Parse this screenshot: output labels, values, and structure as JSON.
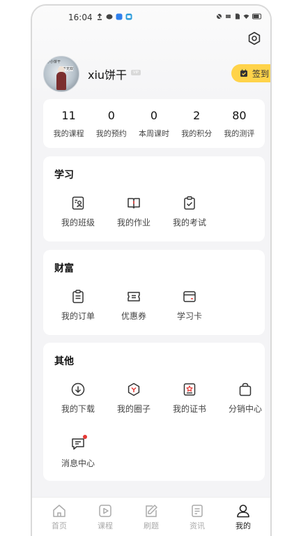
{
  "status_bar": {
    "time": "16:04"
  },
  "profile": {
    "username": "xiu饼干",
    "vip_badge": "VIP",
    "checkin_label": "签到",
    "avatar_text_1": "小小饼干",
    "avatar_text_2": "天下无双"
  },
  "stats": [
    {
      "value": "11",
      "label": "我的课程"
    },
    {
      "value": "0",
      "label": "我的预约"
    },
    {
      "value": "0",
      "label": "本周课时"
    },
    {
      "value": "2",
      "label": "我的积分"
    },
    {
      "value": "80",
      "label": "我的测评"
    }
  ],
  "sections": {
    "study": {
      "title": "学习",
      "items": [
        {
          "label": "我的班级",
          "icon": "class-icon"
        },
        {
          "label": "我的作业",
          "icon": "homework-icon"
        },
        {
          "label": "我的考试",
          "icon": "exam-icon"
        }
      ]
    },
    "wealth": {
      "title": "财富",
      "items": [
        {
          "label": "我的订单",
          "icon": "order-icon"
        },
        {
          "label": "优惠券",
          "icon": "coupon-icon"
        },
        {
          "label": "学习卡",
          "icon": "card-icon"
        }
      ]
    },
    "other": {
      "title": "其他",
      "items": [
        {
          "label": "我的下载",
          "icon": "download-icon"
        },
        {
          "label": "我的圈子",
          "icon": "circle-icon"
        },
        {
          "label": "我的证书",
          "icon": "certificate-icon"
        },
        {
          "label": "分销中心",
          "icon": "shopping-bag-icon"
        },
        {
          "label": "消息中心",
          "icon": "message-icon"
        }
      ]
    }
  },
  "tabbar": [
    {
      "label": "首页",
      "icon": "home-icon",
      "active": false
    },
    {
      "label": "课程",
      "icon": "play-icon",
      "active": false
    },
    {
      "label": "刷题",
      "icon": "edit-icon",
      "active": false
    },
    {
      "label": "资讯",
      "icon": "news-icon",
      "active": false
    },
    {
      "label": "我的",
      "icon": "user-icon",
      "active": true
    }
  ],
  "colors": {
    "accent": "#ffd34a",
    "icon": "#333333",
    "tab_inactive": "#aaaaaa",
    "badge_dot": "#e53935"
  }
}
